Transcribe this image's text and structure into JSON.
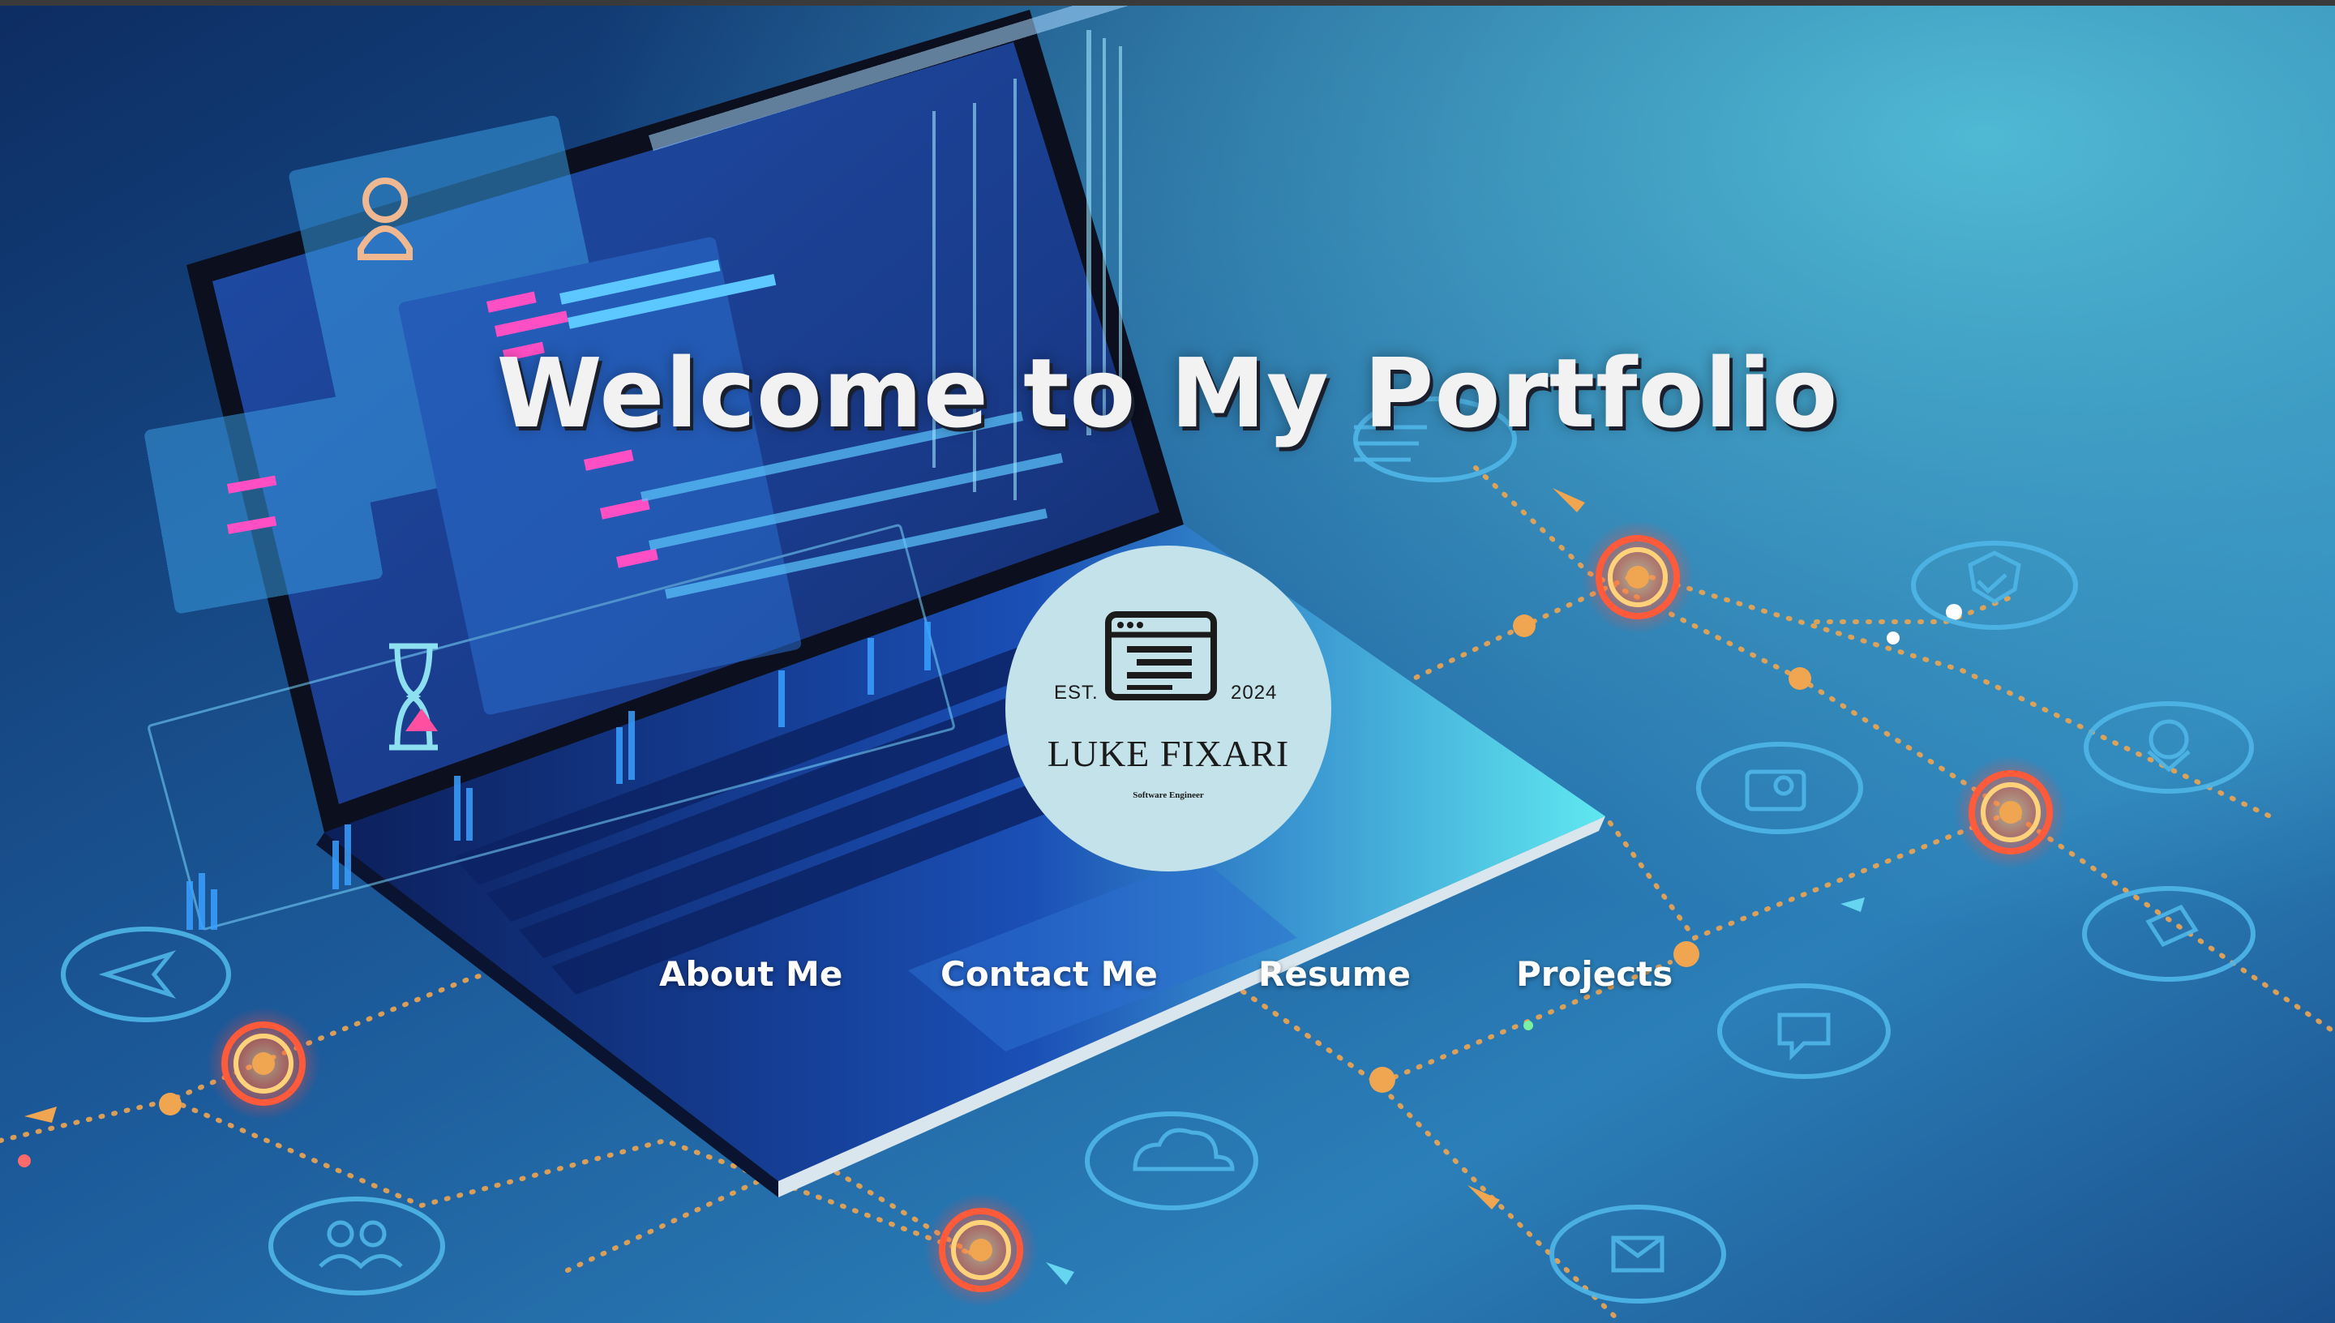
{
  "hero": {
    "title": "Welcome to My Portfolio"
  },
  "logo": {
    "icon": "browser-window-icon",
    "est_label": "EST.",
    "year": "2024",
    "name": "LUKE FIXARI",
    "role": "Software Engineer"
  },
  "nav": {
    "items": [
      {
        "label": "About Me"
      },
      {
        "label": "Contact Me"
      },
      {
        "label": "Resume"
      },
      {
        "label": "Projects"
      }
    ]
  },
  "colors": {
    "background": "#0b2c5c",
    "title": "#f2f2f2",
    "logo_circle": "#c4e2ea",
    "nav_text": "#ffffff",
    "node_glow": "#ff6a3c",
    "dotted_line": "#f0a550",
    "icon_circle": "#4fb6e8"
  }
}
